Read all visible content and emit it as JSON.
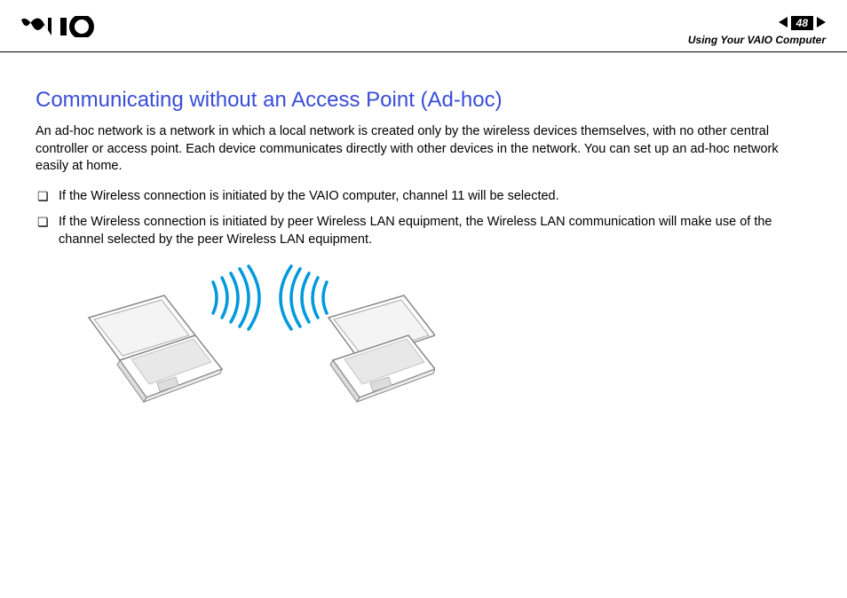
{
  "header": {
    "page_number": "48",
    "breadcrumb": "Using Your VAIO Computer"
  },
  "content": {
    "title": "Communicating without an Access Point (Ad-hoc)",
    "intro": "An ad-hoc network is a network in which a local network is created only by the wireless devices themselves, with no other central controller or access point. Each device communicates directly with other devices in the network. You can set up an ad-hoc network easily at home.",
    "bullets": [
      "If the Wireless connection is initiated by the VAIO computer, channel 11 will be selected.",
      "If the Wireless connection is initiated by peer Wireless LAN equipment, the Wireless LAN communication will make use of the channel selected by the peer Wireless LAN equipment."
    ]
  }
}
